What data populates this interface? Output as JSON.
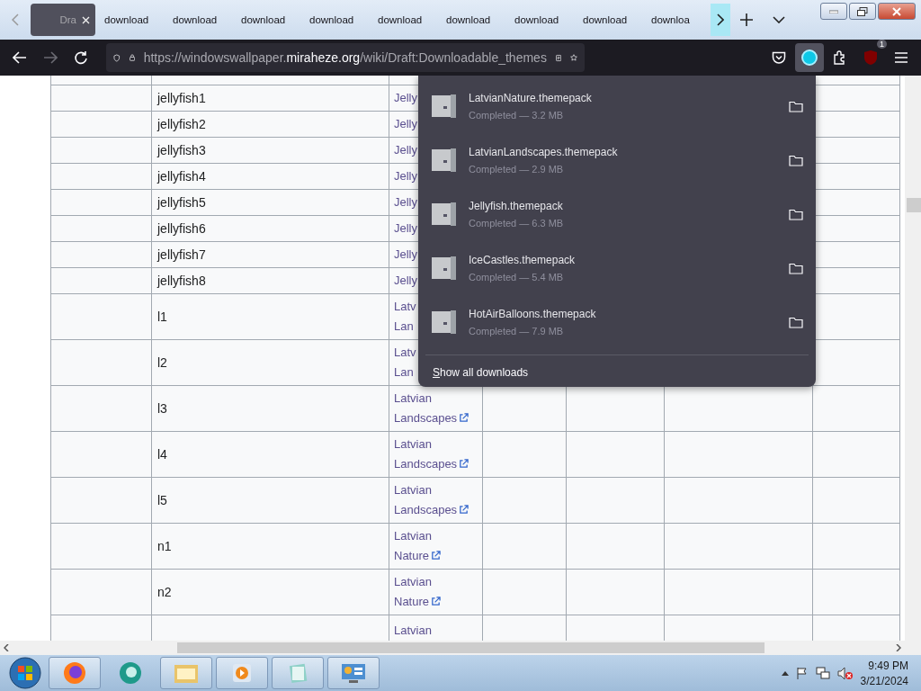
{
  "browser": {
    "tabs": [
      {
        "label": "Dra",
        "selected": true
      },
      {
        "label": "download",
        "selected": false
      },
      {
        "label": "download",
        "selected": false
      },
      {
        "label": "download",
        "selected": false
      },
      {
        "label": "download",
        "selected": false
      },
      {
        "label": "download",
        "selected": false
      },
      {
        "label": "download",
        "selected": false
      },
      {
        "label": "download",
        "selected": false
      },
      {
        "label": "download",
        "selected": false
      },
      {
        "label": "downloa",
        "selected": false
      }
    ],
    "url": {
      "prefix": "https://windowswallpaper.",
      "domain": "miraheze.org",
      "path": "/wiki/Draft:Downloadable_themes"
    },
    "extension_badge": "1"
  },
  "table": {
    "rows": [
      {
        "name": "jellyfish1",
        "link": "Jelly",
        "external": false
      },
      {
        "name": "jellyfish2",
        "link": "Jelly",
        "external": false
      },
      {
        "name": "jellyfish3",
        "link": "Jelly",
        "external": false
      },
      {
        "name": "jellyfish4",
        "link": "Jelly",
        "external": false
      },
      {
        "name": "jellyfish5",
        "link": "Jelly",
        "external": false
      },
      {
        "name": "jellyfish6",
        "link": "Jelly",
        "external": false
      },
      {
        "name": "jellyfish7",
        "link": "Jelly",
        "external": false
      },
      {
        "name": "jellyfish8",
        "link": "Jelly",
        "external": false
      },
      {
        "name": "l1",
        "link": "Latv\nLan",
        "external": false
      },
      {
        "name": "l2",
        "link": "Latv\nLan",
        "external": false
      },
      {
        "name": "l3",
        "link": "Latvian\nLandscapes",
        "external": true
      },
      {
        "name": "l4",
        "link": "Latvian\nLandscapes",
        "external": true
      },
      {
        "name": "l5",
        "link": "Latvian\nLandscapes",
        "external": true
      },
      {
        "name": "n1",
        "link": "Latvian\nNature",
        "external": true
      },
      {
        "name": "n2",
        "link": "Latvian\nNature",
        "external": true
      },
      {
        "link": "Latvian",
        "external": false
      }
    ]
  },
  "downloads": {
    "items": [
      {
        "file": "LatvianNature.themepack",
        "status": "Completed — 3.2 MB"
      },
      {
        "file": "LatvianLandscapes.themepack",
        "status": "Completed — 2.9 MB"
      },
      {
        "file": "Jellyfish.themepack",
        "status": "Completed — 6.3 MB"
      },
      {
        "file": "IceCastles.themepack",
        "status": "Completed — 5.4 MB"
      },
      {
        "file": "HotAirBalloons.themepack",
        "status": "Completed — 7.9 MB"
      }
    ],
    "footer": "Show all downloads"
  },
  "taskbar": {
    "time": "9:49 PM",
    "date": "3/21/2024"
  }
}
